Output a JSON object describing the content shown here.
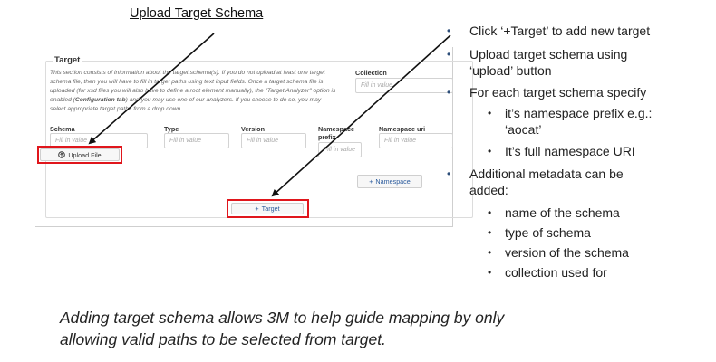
{
  "slide_title": "Upload Target Schema",
  "form": {
    "legend": "Target",
    "description_parts": [
      "This section consists of information about the target schema(s). If you do not upload at least one target schema file, then you will have to fill in target paths using text input fields. Once a target schema file is uploaded (for xsd files you will also have to define a root element manually), the \"Target Analyzer\" option is enabled (",
      "Configuration tab",
      ") and you may use one of our analyzers. If you choose to do so, you may select appropriate target paths from a drop down."
    ],
    "collection_label": "Collection",
    "placeholder": "Fill in value",
    "columns": {
      "schema": "Schema",
      "type": "Type",
      "version": "Version",
      "namespace_prefix": "Namespace prefix",
      "namespace_uri": "Namespace uri"
    },
    "upload_button": "Upload File",
    "namespace_button": "Namespace",
    "target_button": "Target",
    "icons": {
      "upload": "upload-icon",
      "plus": "plus-icon"
    }
  },
  "bullets": [
    {
      "level": 1,
      "text": "Click ‘+Target’ to add new target"
    },
    {
      "level": 1,
      "text": "Upload target schema using"
    },
    {
      "level": 0,
      "text": "‘upload’ button"
    },
    {
      "level": 1,
      "text": "For each target schema specify"
    },
    {
      "level": 2,
      "text": "it’s namespace prefix e.g.:"
    },
    {
      "level": 0,
      "text": "‘aocat’"
    },
    {
      "level": 2,
      "text": "It’s full namespace URI"
    },
    {
      "level": 1,
      "text": "Additional metadata can be"
    },
    {
      "level": 0,
      "text": "added:"
    },
    {
      "level": 2,
      "text": "name of the schema"
    },
    {
      "level": 2,
      "text": "type of schema"
    },
    {
      "level": 2,
      "text": "version of the schema"
    },
    {
      "level": 2,
      "text": "collection used for"
    }
  ],
  "caption_lines": [
    "Adding target schema allows 3M to help guide mapping by only",
    "allowing valid paths to be selected from target."
  ],
  "colors": {
    "highlight": "#e0161c",
    "bullet_dot": "#2d4e7a",
    "button_text": "#2a5a9c"
  }
}
